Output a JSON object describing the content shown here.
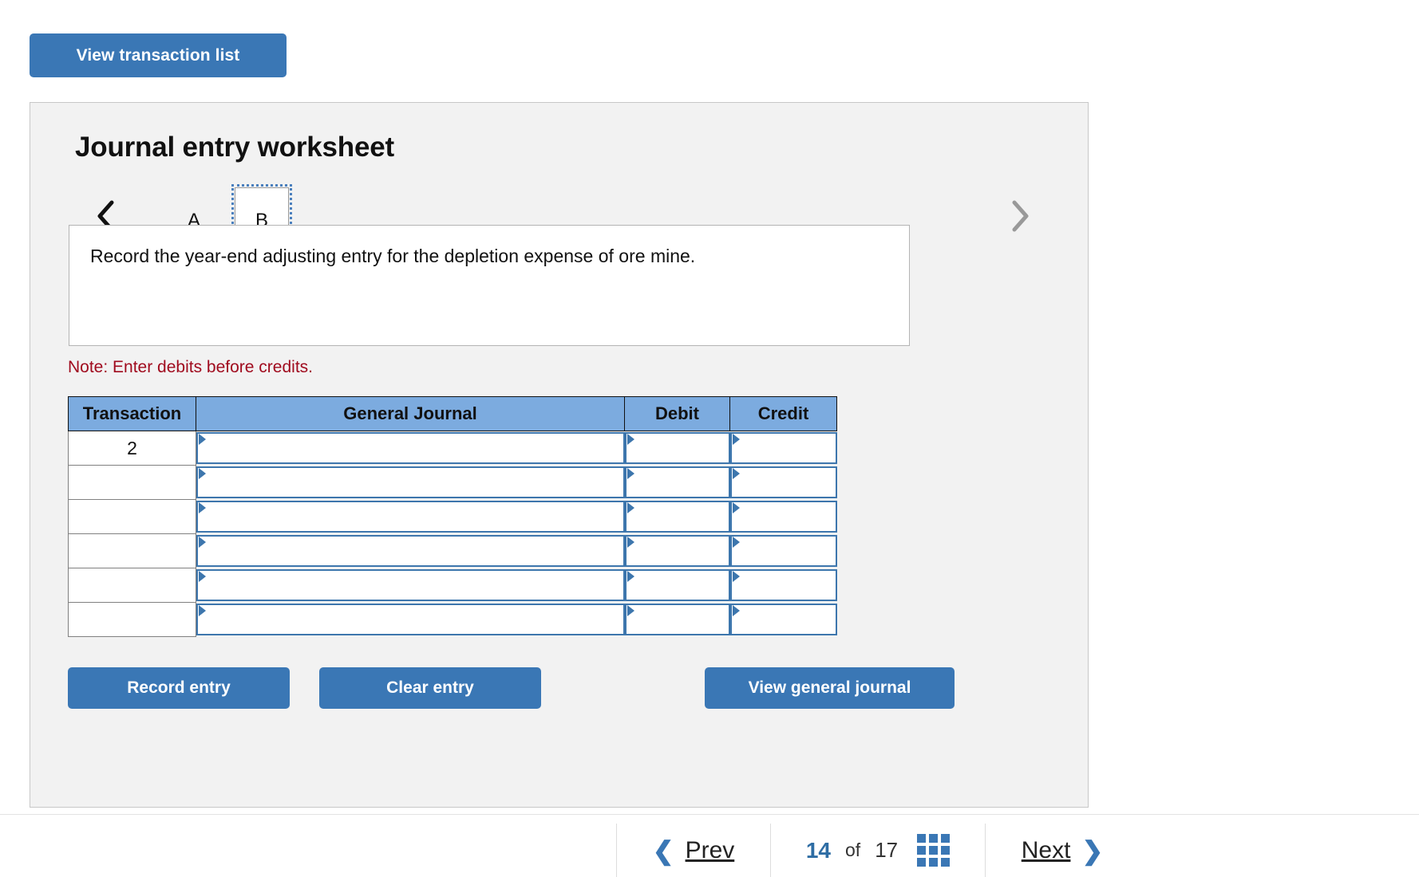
{
  "top_action": {
    "view_transaction_list_label": "View transaction list"
  },
  "worksheet": {
    "title": "Journal entry worksheet",
    "tabs": [
      {
        "label": "A",
        "selected": false
      },
      {
        "label": "B",
        "selected": true
      }
    ],
    "nav_prev_icon": "chevron-left-icon",
    "nav_next_icon": "chevron-right-icon",
    "description": "Record the year-end adjusting entry for the depletion expense of ore mine.",
    "note": "Note: Enter debits before credits."
  },
  "journal_table": {
    "headers": [
      "Transaction",
      "General Journal",
      "Debit",
      "Credit"
    ],
    "rows": [
      {
        "transaction": "2",
        "general_journal": "",
        "debit": "",
        "credit": ""
      },
      {
        "transaction": "",
        "general_journal": "",
        "debit": "",
        "credit": ""
      },
      {
        "transaction": "",
        "general_journal": "",
        "debit": "",
        "credit": ""
      },
      {
        "transaction": "",
        "general_journal": "",
        "debit": "",
        "credit": ""
      },
      {
        "transaction": "",
        "general_journal": "",
        "debit": "",
        "credit": ""
      },
      {
        "transaction": "",
        "general_journal": "",
        "debit": "",
        "credit": ""
      }
    ]
  },
  "actions": {
    "record_entry_label": "Record entry",
    "clear_entry_label": "Clear entry",
    "view_general_journal_label": "View general journal"
  },
  "footer": {
    "prev_label": "Prev",
    "next_label": "Next",
    "current_page": "14",
    "of_label": "of",
    "total_pages": "17",
    "grid_icon": "grid-3x3-icon"
  },
  "colors": {
    "brand_blue": "#3a77b5",
    "header_blue": "#7cabdf",
    "note_red": "#a00b1e",
    "panel_gray": "#f2f2f2",
    "cell_border_blue": "#3d76ad"
  }
}
